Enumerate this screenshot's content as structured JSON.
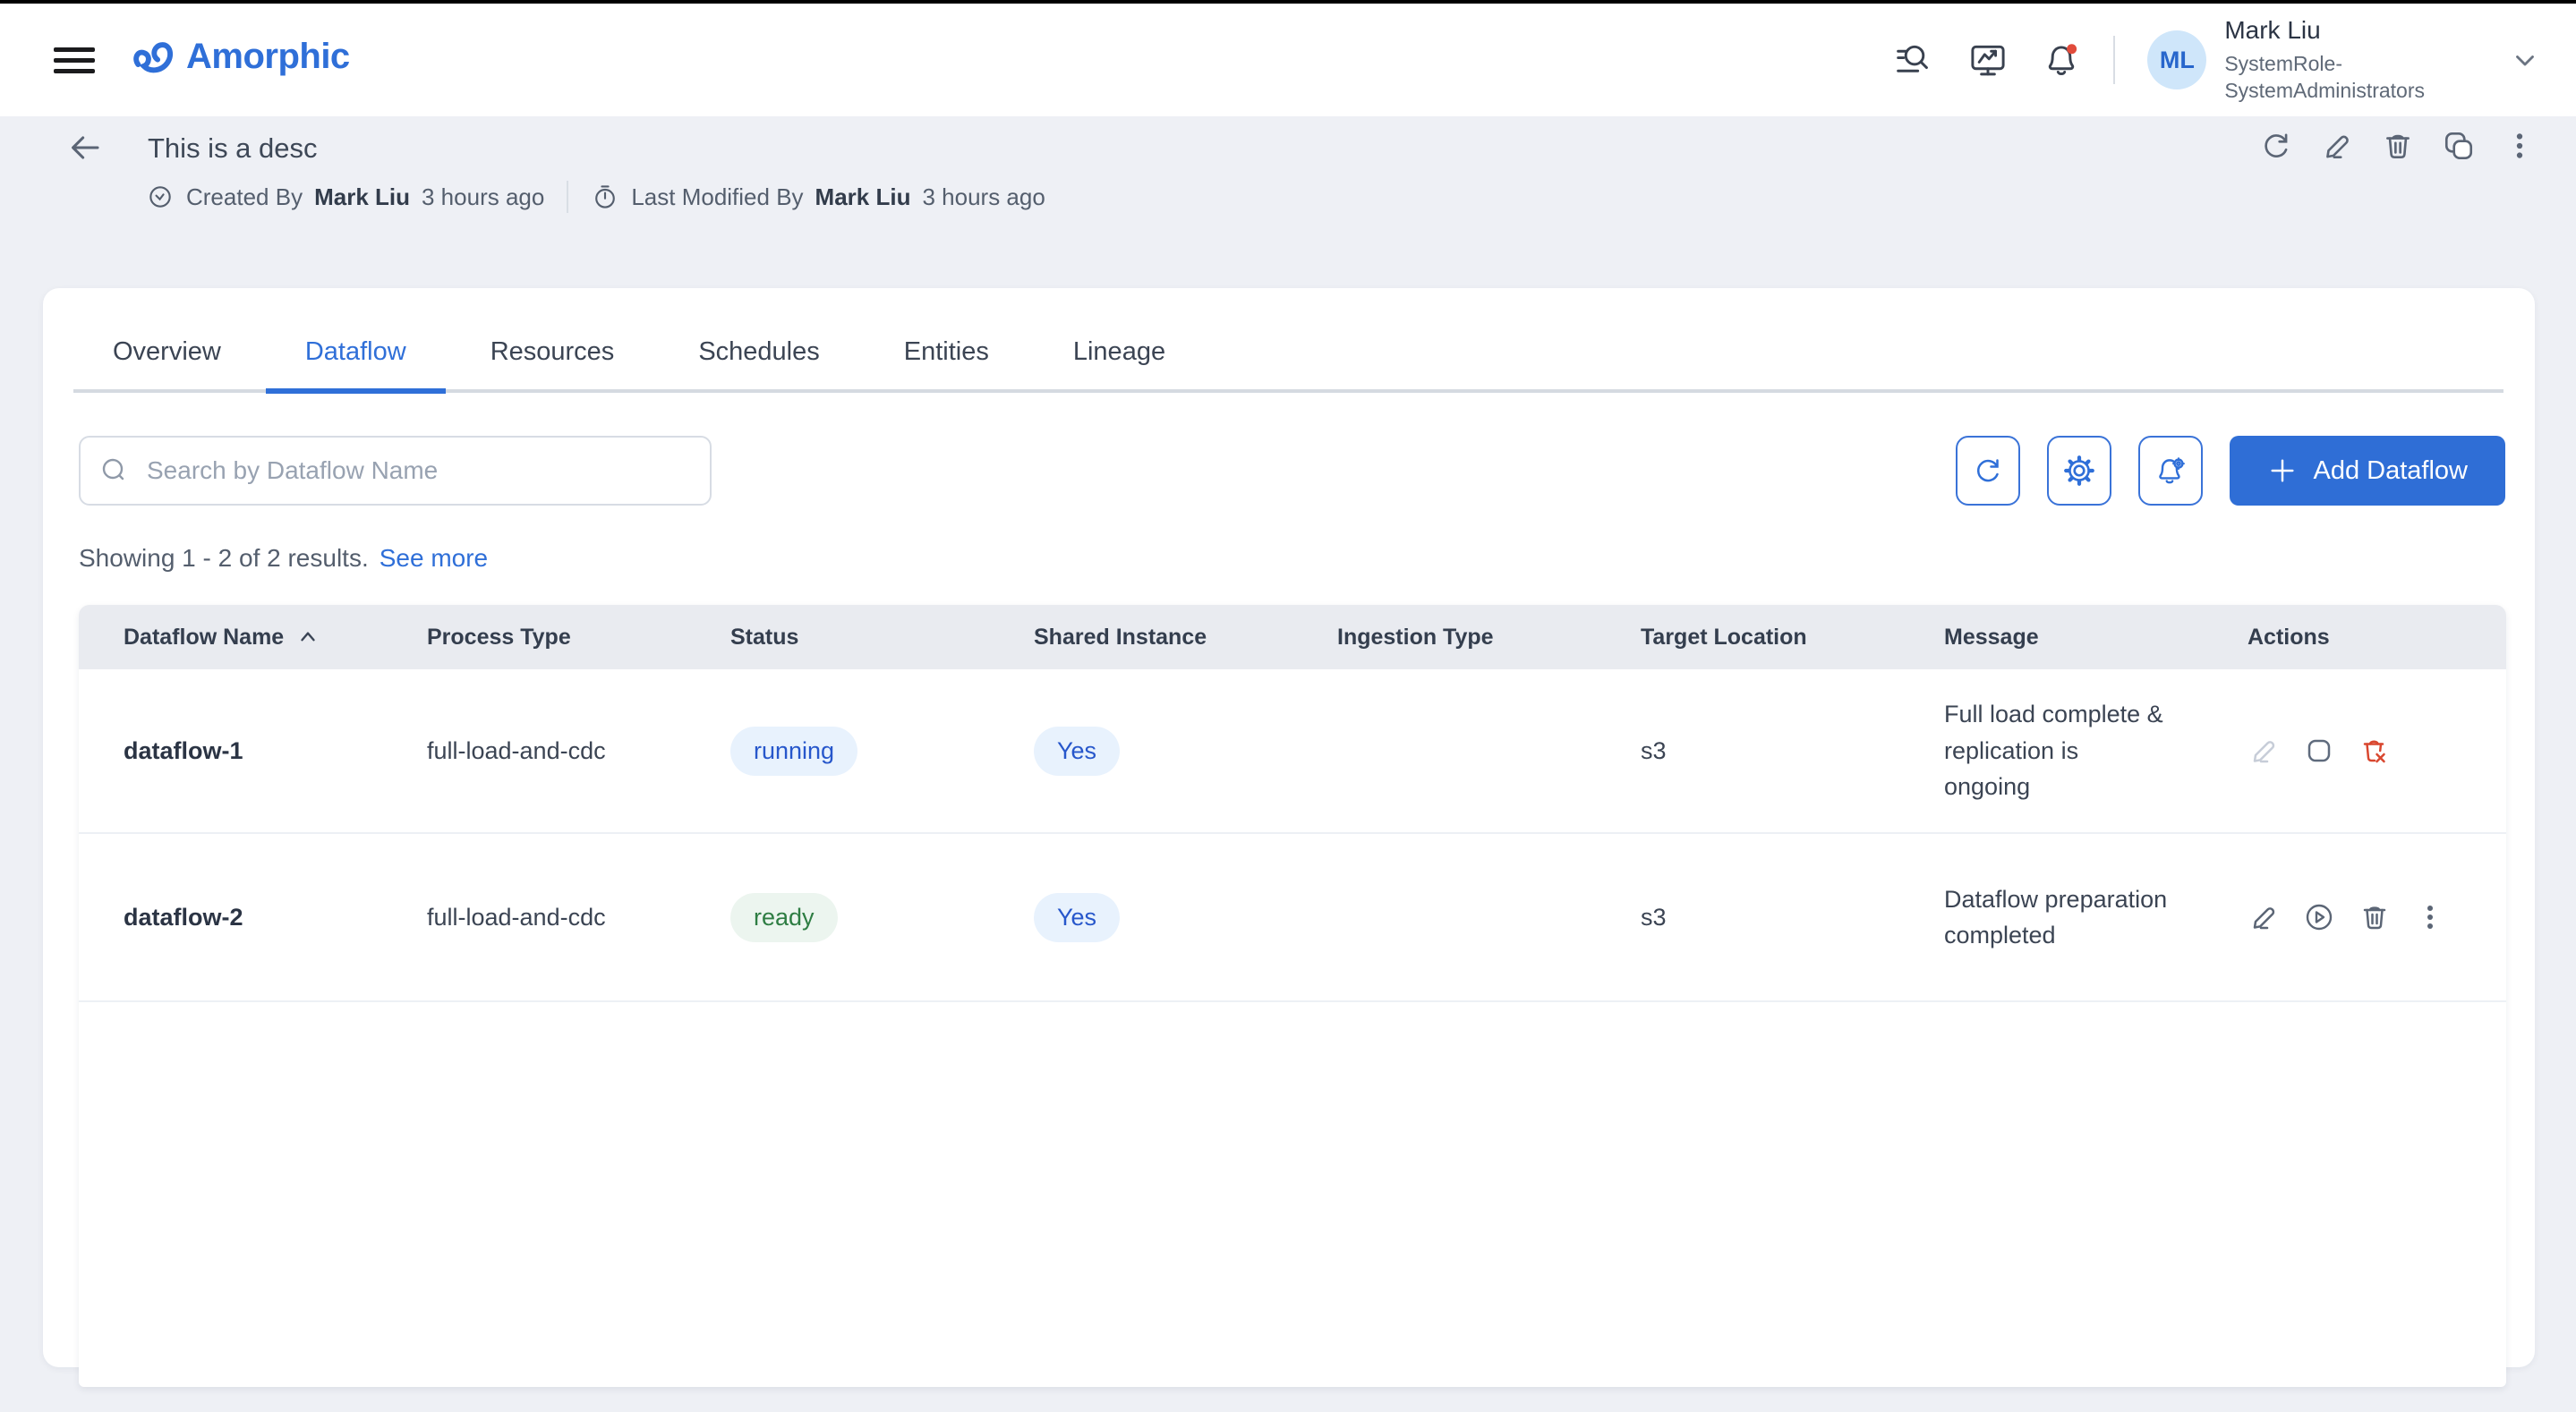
{
  "colors": {
    "primary_blue": "#2f6fd8",
    "status_running_text": "#2757cb",
    "status_running_bg": "#e8f2fd",
    "status_ready_text": "#2e7d43",
    "status_ready_bg": "#ecf5ef",
    "danger_red": "#d9472f",
    "avatar_bg": "#cfe6fa",
    "table_header_bg": "#e9ebf0",
    "page_bg": "#eef0f5"
  },
  "header": {
    "brand": "Amorphic",
    "icons": [
      "global-search-icon",
      "monitoring-icon",
      "notifications-icon"
    ],
    "notification_dot": true,
    "user": {
      "initials": "ML",
      "name": "Mark Liu",
      "role_line1": "SystemRole-",
      "role_line2": "SystemAdministrators"
    }
  },
  "page_header": {
    "title": "This is a desc",
    "created_label": "Created By",
    "created_user": "Mark Liu",
    "created_time": "3 hours ago",
    "modified_label": "Last Modified By",
    "modified_user": "Mark Liu",
    "modified_time": "3 hours ago",
    "actions": [
      "refresh-icon",
      "edit-icon",
      "delete-icon",
      "copy-icon",
      "more-icon"
    ]
  },
  "tabs": {
    "items": [
      {
        "label": "Overview",
        "active": false
      },
      {
        "label": "Dataflow",
        "active": true
      },
      {
        "label": "Resources",
        "active": false
      },
      {
        "label": "Schedules",
        "active": false
      },
      {
        "label": "Entities",
        "active": false
      },
      {
        "label": "Lineage",
        "active": false
      }
    ]
  },
  "toolbar": {
    "search_placeholder": "Search by Dataflow Name",
    "buttons": [
      "refresh-icon",
      "settings-icon",
      "alert-settings-icon"
    ],
    "add_label": "Add Dataflow"
  },
  "results_bar": {
    "showing": "Showing 1 - 2 of 2 results.",
    "see_more": "See more"
  },
  "table": {
    "columns": [
      "Dataflow Name",
      "Process Type",
      "Status",
      "Shared Instance",
      "Ingestion Type",
      "Target Location",
      "Message",
      "Actions"
    ],
    "sorted_column": "Dataflow Name",
    "sort_direction": "asc",
    "rows": [
      {
        "name": "dataflow-1",
        "process_type": "full-load-and-cdc",
        "status": "running",
        "shared_instance": "Yes",
        "ingestion_type": "",
        "target_location": "s3",
        "message": "Full load complete & replication is ongoing",
        "actions": [
          "edit-disabled",
          "stop",
          "delete-cancel"
        ]
      },
      {
        "name": "dataflow-2",
        "process_type": "full-load-and-cdc",
        "status": "ready",
        "shared_instance": "Yes",
        "ingestion_type": "",
        "target_location": "s3",
        "message": "Dataflow preparation completed",
        "actions": [
          "edit",
          "run",
          "delete",
          "more"
        ]
      }
    ]
  }
}
